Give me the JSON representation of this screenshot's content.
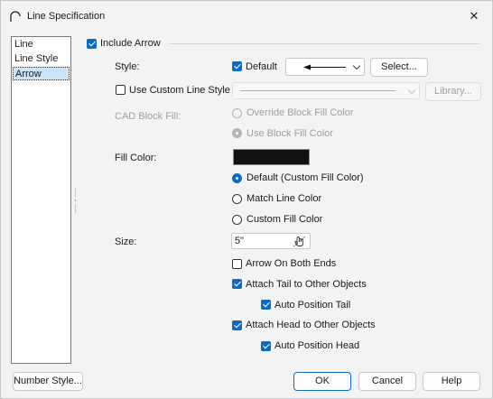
{
  "window": {
    "title": "Line Specification",
    "close_glyph": "✕",
    "icon": "arc-icon"
  },
  "sidebar": {
    "items": [
      {
        "label": "Line",
        "selected": false
      },
      {
        "label": "Line Style",
        "selected": false
      },
      {
        "label": "Arrow",
        "selected": true
      }
    ]
  },
  "arrow": {
    "include_arrow": {
      "label": "Include Arrow",
      "checked": true
    },
    "style": {
      "label": "Style:",
      "default_label": "Default",
      "default_checked": true,
      "select_label": "Select..."
    },
    "custom_line_style": {
      "label": "Use Custom Line Style",
      "checked": false,
      "library_label": "Library..."
    },
    "cad_block_fill": {
      "label": "CAD Block Fill:",
      "options": [
        {
          "label": "Override Block Fill Color",
          "checked": false
        },
        {
          "label": "Use Block Fill Color",
          "checked": true
        }
      ]
    },
    "fill_color": {
      "label": "Fill Color:",
      "swatch_color": "#111111",
      "options": [
        {
          "label": "Default (Custom Fill Color)",
          "checked": true
        },
        {
          "label": "Match Line Color",
          "checked": false
        },
        {
          "label": "Custom Fill Color",
          "checked": false
        }
      ]
    },
    "size": {
      "label": "Size:",
      "value": "5\""
    },
    "arrow_both_ends": {
      "label": "Arrow On Both Ends",
      "checked": false
    },
    "attach_tail": {
      "label": "Attach Tail to Other Objects",
      "checked": true
    },
    "auto_position_tail": {
      "label": "Auto Position Tail",
      "checked": true
    },
    "attach_head": {
      "label": "Attach Head to Other Objects",
      "checked": true
    },
    "auto_position_head": {
      "label": "Auto Position Head",
      "checked": true
    }
  },
  "footer": {
    "number_style": "Number Style...",
    "ok": "OK",
    "cancel": "Cancel",
    "help": "Help"
  },
  "colors": {
    "accent": "#0f6cbd",
    "selection": "#cce4f7"
  }
}
